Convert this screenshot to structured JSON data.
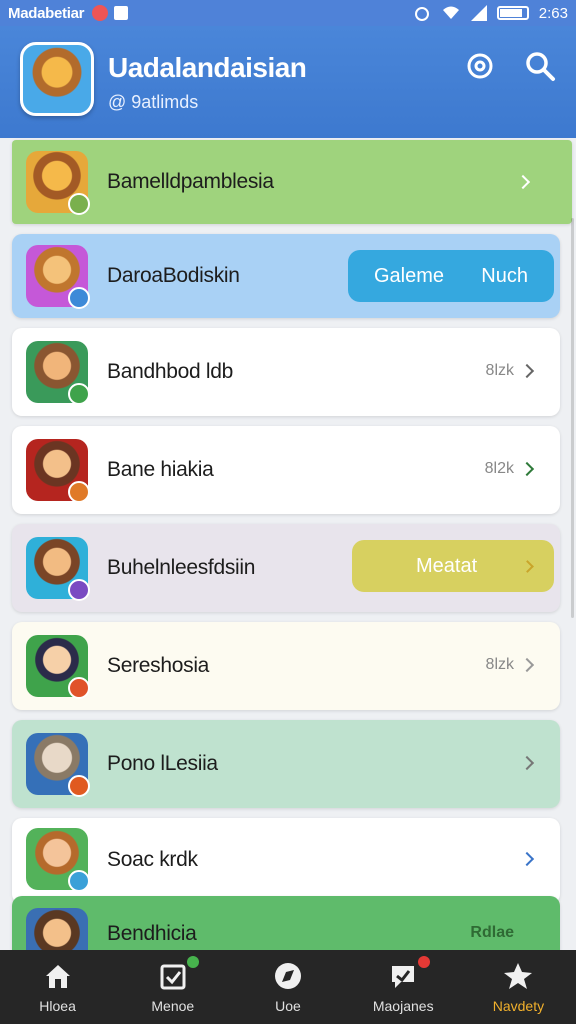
{
  "status_bar": {
    "carrier": "Madabetiar",
    "time": "2:63"
  },
  "header": {
    "title": "Uadalandaisian",
    "subtitle": "@ 9atlimds"
  },
  "rows": [
    {
      "label": "Bamelldpamblesia",
      "meta": "",
      "bg": "#9fd37d",
      "badge": "#7ab04d"
    },
    {
      "label": "DaroaBodiskin",
      "bg": "#a9d1f5",
      "badge": "#3d8ad8",
      "pill_left": "Galeme",
      "pill_right": "Nuch",
      "pill_color": "#35a8df"
    },
    {
      "label": "Bandhbod ldb",
      "meta": "8lzk",
      "bg": "#ffffff",
      "badge": "#3fa34b"
    },
    {
      "label": "Bane hiakia",
      "meta": "8l2k",
      "bg": "#ffffff",
      "badge": "#e07a28"
    },
    {
      "label": "Buhelnleesfdsiin",
      "bg": "#e8e4ec",
      "badge": "#7a4ac2",
      "pill_left": "Meatat",
      "pill_color": "#d7d060"
    },
    {
      "label": "Sereshosia",
      "meta": "8lzk",
      "bg": "#fdfbf1",
      "badge": "#e0532a"
    },
    {
      "label": "Pono lLesiia",
      "meta": "",
      "bg": "#bfe2cf",
      "badge": "#e05a20"
    },
    {
      "label": "Soac krdk",
      "meta": "",
      "bg": "#ffffff",
      "badge": "#3aa0d8"
    },
    {
      "label": "Bendhicia",
      "meta": "Rdlae",
      "bg": "#5fbb6b",
      "badge": "#c25a2a"
    }
  ],
  "nav": [
    {
      "label": "Hloea",
      "icon": "home-icon"
    },
    {
      "label": "Menoe",
      "icon": "inbox-icon"
    },
    {
      "label": "Uoe",
      "icon": "compass-icon"
    },
    {
      "label": "Maojanes",
      "icon": "message-icon"
    },
    {
      "label": "Navdety",
      "icon": "star-icon",
      "active": true
    }
  ],
  "colors": {
    "header": "#3d79cf",
    "nav_bg": "#262626",
    "nav_active": "#f1b02c"
  }
}
